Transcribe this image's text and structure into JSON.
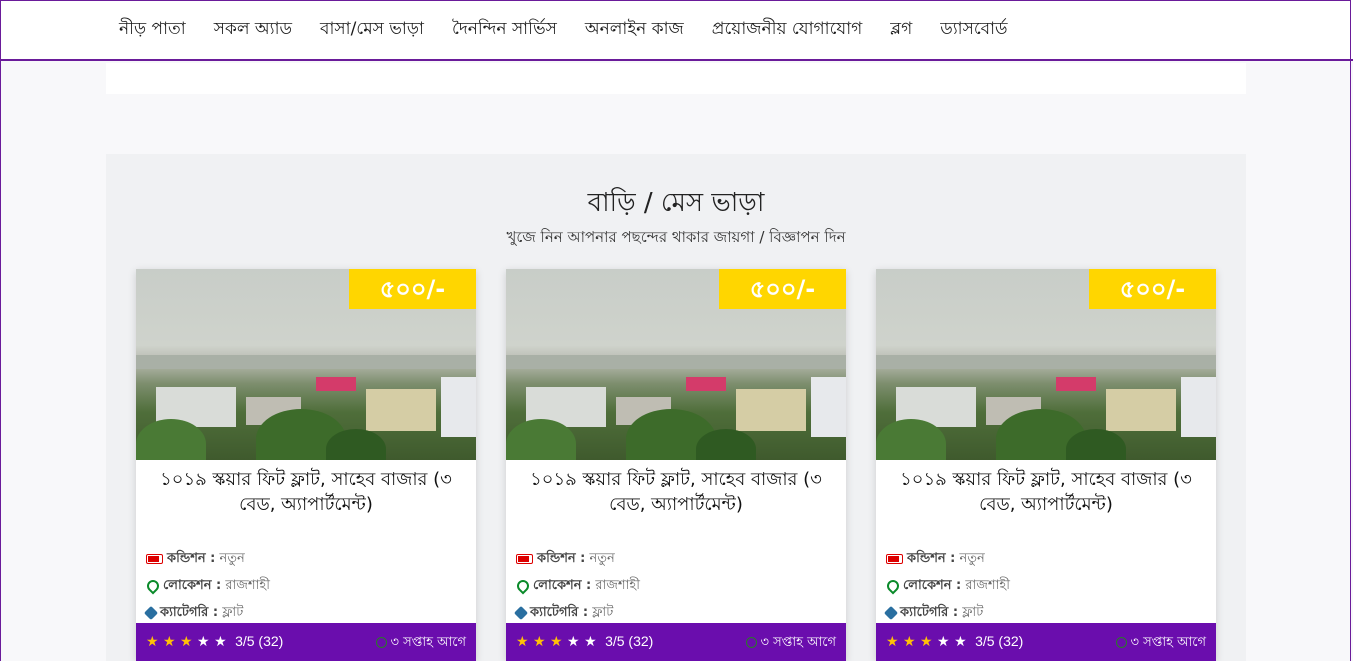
{
  "nav": {
    "items": [
      {
        "label": "নীড় পাতা"
      },
      {
        "label": "সকল অ্যাড"
      },
      {
        "label": "বাসা/মেস ভাড়া"
      },
      {
        "label": "দৈনন্দিন সার্ভিস"
      },
      {
        "label": "অনলাইন কাজ"
      },
      {
        "label": "প্রয়োজনীয় যোগাযোগ"
      },
      {
        "label": "ব্লগ"
      },
      {
        "label": "ড্যাসবোর্ড"
      }
    ]
  },
  "section": {
    "title": "বাড়ি / মেস ভাড়া",
    "subtitle": "খুজে নিন আপনার পছন্দের থাকার জায়গা / বিজ্ঞাপন দিন"
  },
  "colors": {
    "accent": "#6a0dad",
    "price_bg": "#ffd600",
    "star": "#ffc107"
  },
  "cards": [
    {
      "price": "৫০০/-",
      "title": "১০১৯ স্কয়ার ফিট ফ্লাট, সাহেব বাজার (৩ বেড, অ্যাপার্টমেন্ট)",
      "condition_label": "কন্ডিশন :",
      "condition_value": "নতুন",
      "location_label": "লোকেশন :",
      "location_value": "রাজশাহী",
      "category_label": "ক্যাটেগরি :",
      "category_value": "ফ্লাট",
      "rating": "3/5 (32)",
      "stars_filled": 3,
      "stars_total": 5,
      "time": "৩ সপ্তাহ আগে"
    },
    {
      "price": "৫০০/-",
      "title": "১০১৯ স্কয়ার ফিট ফ্লাট, সাহেব বাজার (৩ বেড, অ্যাপার্টমেন্ট)",
      "condition_label": "কন্ডিশন :",
      "condition_value": "নতুন",
      "location_label": "লোকেশন :",
      "location_value": "রাজশাহী",
      "category_label": "ক্যাটেগরি :",
      "category_value": "ফ্লাট",
      "rating": "3/5 (32)",
      "stars_filled": 3,
      "stars_total": 5,
      "time": "৩ সপ্তাহ আগে"
    },
    {
      "price": "৫০০/-",
      "title": "১০১৯ স্কয়ার ফিট ফ্লাট, সাহেব বাজার (৩ বেড, অ্যাপার্টমেন্ট)",
      "condition_label": "কন্ডিশন :",
      "condition_value": "নতুন",
      "location_label": "লোকেশন :",
      "location_value": "রাজশাহী",
      "category_label": "ক্যাটেগরি :",
      "category_value": "ফ্লাট",
      "rating": "3/5 (32)",
      "stars_filled": 3,
      "stars_total": 5,
      "time": "৩ সপ্তাহ আগে"
    }
  ]
}
